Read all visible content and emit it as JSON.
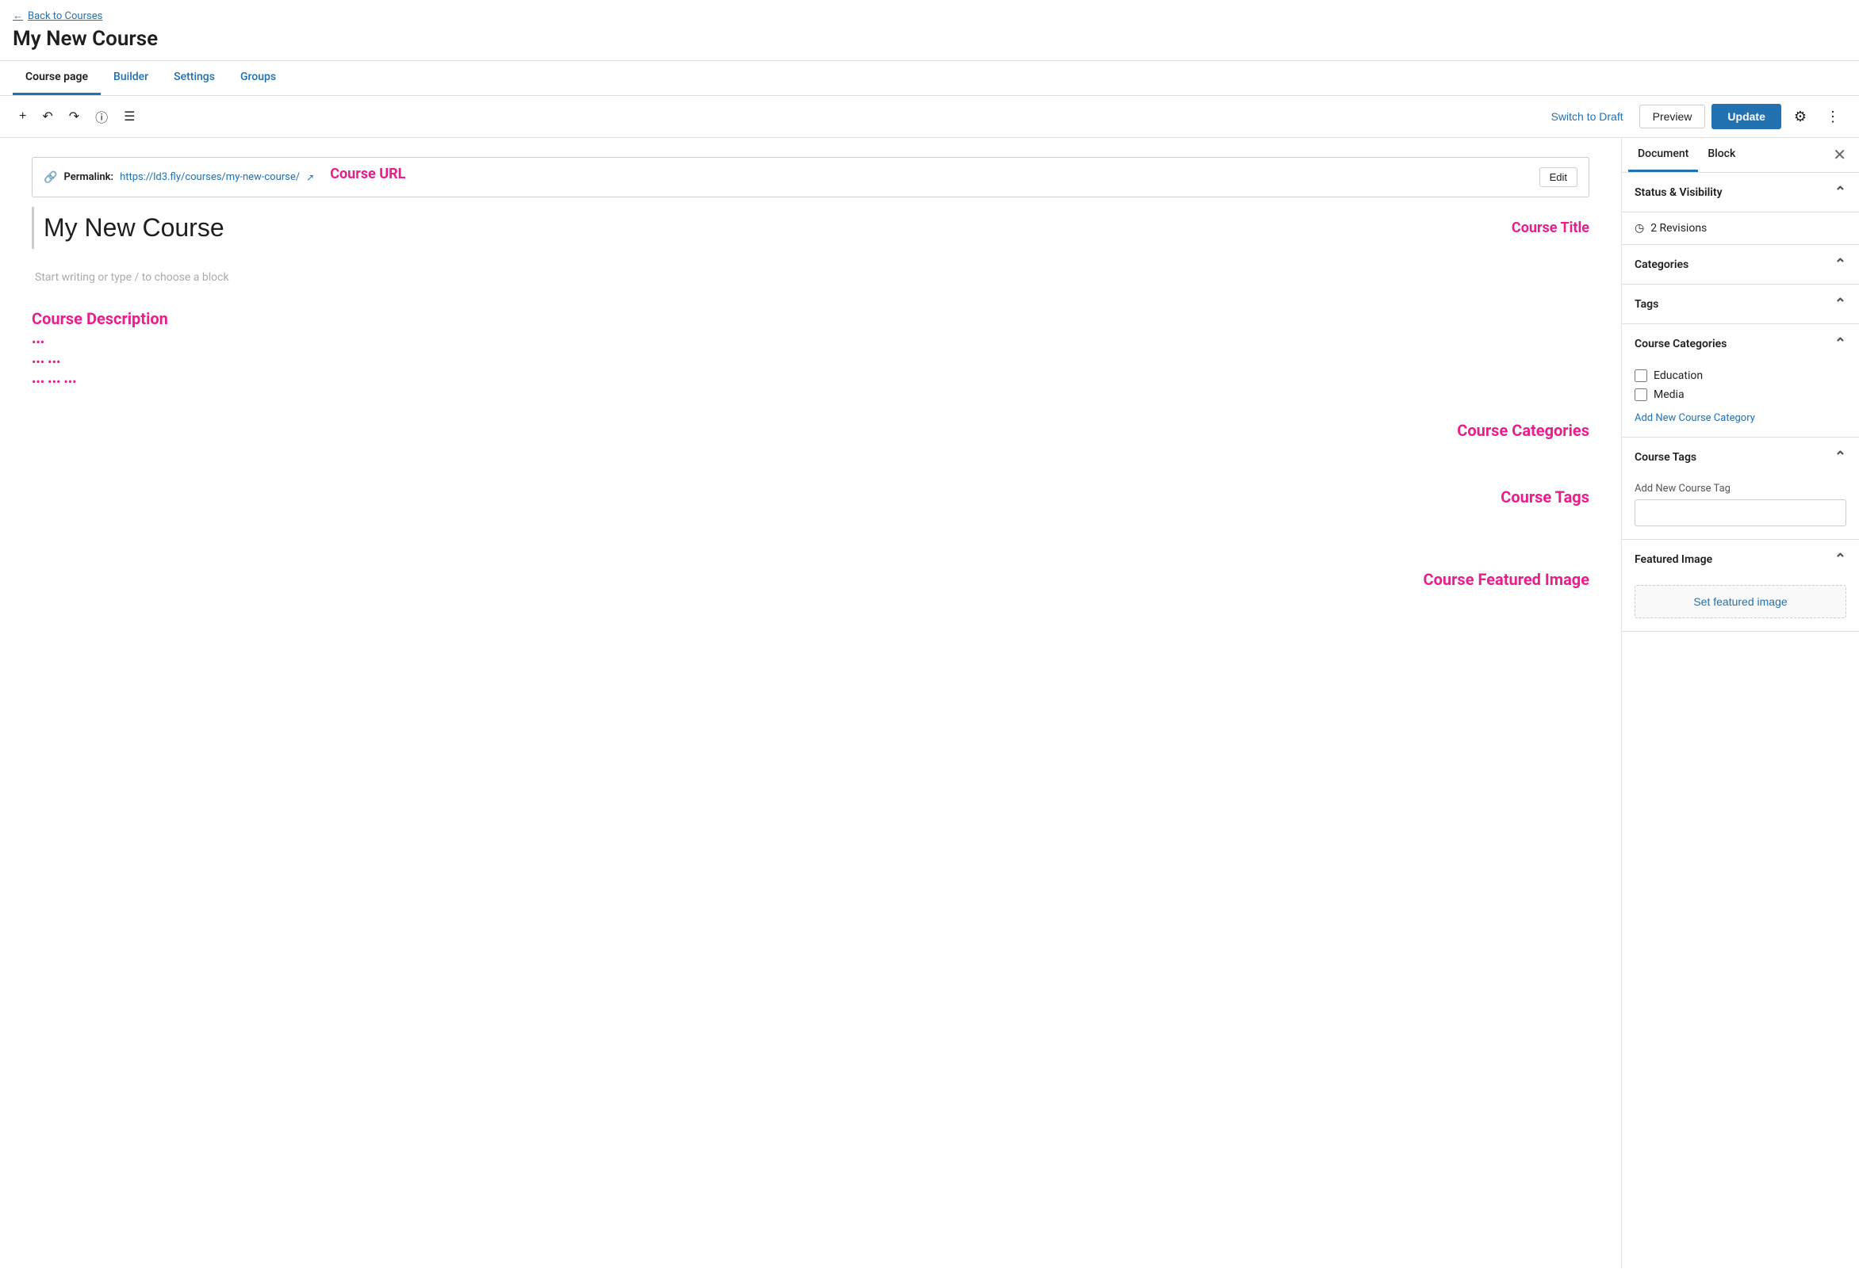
{
  "back_link": "Back to Courses",
  "page_title": "My New Course",
  "tabs": [
    {
      "label": "Course page",
      "active": true
    },
    {
      "label": "Builder",
      "active": false
    },
    {
      "label": "Settings",
      "active": false
    },
    {
      "label": "Groups",
      "active": false
    }
  ],
  "toolbar": {
    "switch_draft": "Switch to Draft",
    "preview": "Preview",
    "update": "Update"
  },
  "permalink": {
    "label": "Permalink:",
    "url": "https://ld3.fly/courses/my-new-course/",
    "edit_label": "Edit"
  },
  "course_title": "My New Course",
  "course_title_annotation": "Course Title",
  "course_url_annotation": "Course URL",
  "content_placeholder": "Start writing or type / to choose a block",
  "course_description_annotation": "Course Description",
  "course_categories_annotation": "Course Categories",
  "course_tags_annotation": "Course Tags",
  "course_featured_image_annotation": "Course Featured Image",
  "dot_lines": [
    "•••",
    "••• •••",
    "••• ••• •••"
  ],
  "sidebar": {
    "document_tab": "Document",
    "block_tab": "Block",
    "status_visibility": "Status & Visibility",
    "revisions_label": "2 Revisions",
    "categories_label": "Categories",
    "tags_label": "Tags",
    "course_categories_label": "Course Categories",
    "categories": [
      {
        "label": "Education",
        "checked": false
      },
      {
        "label": "Media",
        "checked": false
      }
    ],
    "add_new_category": "Add New Course Category",
    "course_tags_label": "Course Tags",
    "tag_input_label": "Add New Course Tag",
    "tag_input_placeholder": "",
    "featured_image_label": "Featured Image",
    "set_featured_image": "Set featured image"
  }
}
